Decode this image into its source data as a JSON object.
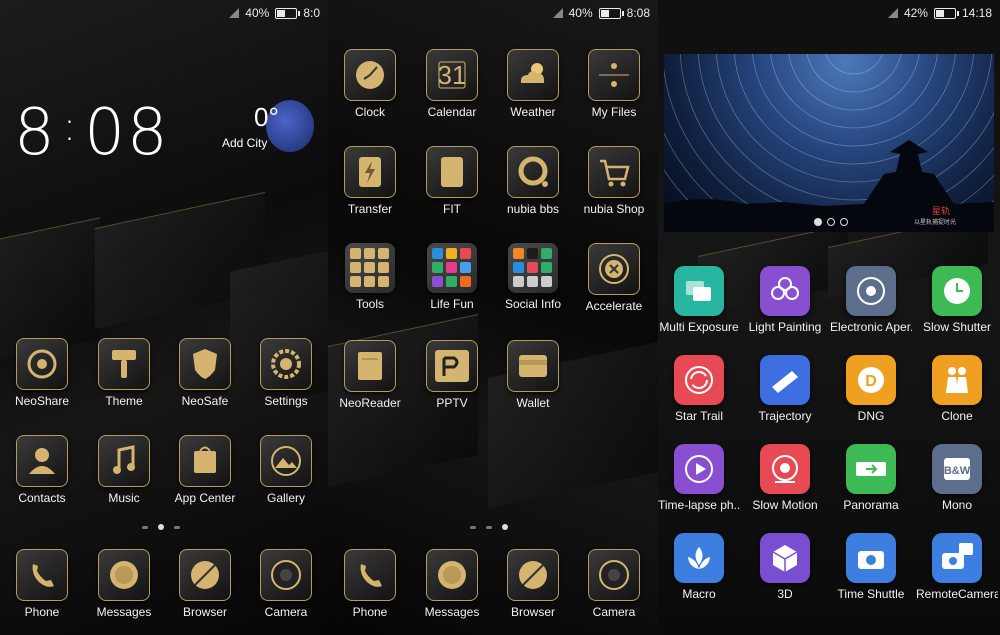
{
  "screens": [
    {
      "status": {
        "battery": "40%",
        "battery_level": 0.4,
        "time": "8:0"
      },
      "clock": {
        "hour": "8",
        "minute": "08"
      },
      "weather": {
        "temp": "0°",
        "city": "Add City"
      },
      "apps": [
        {
          "label": "NeoShare",
          "icon": "neoshare-icon"
        },
        {
          "label": "Theme",
          "icon": "paintbrush-icon"
        },
        {
          "label": "NeoSafe",
          "icon": "shield-icon"
        },
        {
          "label": "Settings",
          "icon": "gear-icon"
        },
        {
          "label": "Contacts",
          "icon": "person-icon"
        },
        {
          "label": "Music",
          "icon": "music-note-icon"
        },
        {
          "label": "App Center",
          "icon": "shopping-bag-icon"
        },
        {
          "label": "Gallery",
          "icon": "mountain-icon"
        }
      ],
      "dock": [
        {
          "label": "Phone",
          "icon": "phone-icon"
        },
        {
          "label": "Messages",
          "icon": "messages-icon"
        },
        {
          "label": "Browser",
          "icon": "compass-icon"
        },
        {
          "label": "Camera",
          "icon": "camera-lens-icon"
        }
      ]
    },
    {
      "status": {
        "battery": "40%",
        "battery_level": 0.4,
        "time": "8:08"
      },
      "apps": [
        {
          "label": "Clock",
          "icon": "clock-icon"
        },
        {
          "label": "Calendar",
          "icon": "calendar-icon",
          "value": "31"
        },
        {
          "label": "Weather",
          "icon": "sun-cloud-icon"
        },
        {
          "label": "My Files",
          "icon": "files-icon"
        },
        {
          "label": "Transfer",
          "icon": "lightning-icon"
        },
        {
          "label": "FIT",
          "icon": "fit-icon"
        },
        {
          "label": "nubia bbs",
          "icon": "bbs-icon"
        },
        {
          "label": "nubia Shop",
          "icon": "cart-icon"
        },
        {
          "label": "Tools",
          "icon": "tools-folder-icon"
        },
        {
          "label": "Life Fun",
          "icon": "lifefun-folder-icon"
        },
        {
          "label": "Social Info",
          "icon": "social-folder-icon"
        },
        {
          "label": "Accelerate",
          "icon": "accelerate-icon"
        },
        {
          "label": "NeoReader",
          "icon": "book-icon"
        },
        {
          "label": "PPTV",
          "icon": "pptv-icon"
        },
        {
          "label": "Wallet",
          "icon": "wallet-icon"
        }
      ],
      "dock": [
        {
          "label": "Phone",
          "icon": "phone-icon"
        },
        {
          "label": "Messages",
          "icon": "messages-icon"
        },
        {
          "label": "Browser",
          "icon": "compass-icon"
        },
        {
          "label": "Camera",
          "icon": "camera-lens-icon"
        }
      ]
    },
    {
      "status": {
        "battery": "42%",
        "battery_level": 0.42,
        "time": "14:18"
      },
      "banner": {
        "caption": "星轨",
        "subcaption": "以星轨捕捉时光"
      },
      "modes": [
        {
          "label": "Multi Exposure",
          "icon": "multi-exposure-icon",
          "color": "#27b6a0"
        },
        {
          "label": "Light Painting",
          "icon": "flower-icon",
          "color": "#8a4ed0"
        },
        {
          "label": "Electronic Aper..",
          "icon": "aperture-icon",
          "color": "#5c6e8c"
        },
        {
          "label": "Slow Shutter",
          "icon": "timer-icon",
          "color": "#3dba55"
        },
        {
          "label": "Star Trail",
          "icon": "star-trail-icon",
          "color": "#e84a55"
        },
        {
          "label": "Trajectory",
          "icon": "trajectory-icon",
          "color": "#3d6fe0"
        },
        {
          "label": "DNG",
          "icon": "dng-icon",
          "color": "#f0a020"
        },
        {
          "label": "Clone",
          "icon": "clone-icon",
          "color": "#f0a020"
        },
        {
          "label": "Time-lapse ph..",
          "icon": "play-icon",
          "color": "#8a4ed0"
        },
        {
          "label": "Slow Motion",
          "icon": "slow-motion-icon",
          "color": "#e84a55"
        },
        {
          "label": "Panorama",
          "icon": "panorama-icon",
          "color": "#3dba55"
        },
        {
          "label": "Mono",
          "icon": "bw-icon",
          "color": "#5c6e8c"
        },
        {
          "label": "Macro",
          "icon": "macro-icon",
          "color": "#3d7fe0"
        },
        {
          "label": "3D",
          "icon": "cube-icon",
          "color": "#7a4ed0"
        },
        {
          "label": "Time Shuttle",
          "icon": "time-shuttle-icon",
          "color": "#3d7fe0"
        },
        {
          "label": "RemoteCamera",
          "icon": "remote-camera-icon",
          "color": "#3d7fe0"
        }
      ]
    }
  ]
}
